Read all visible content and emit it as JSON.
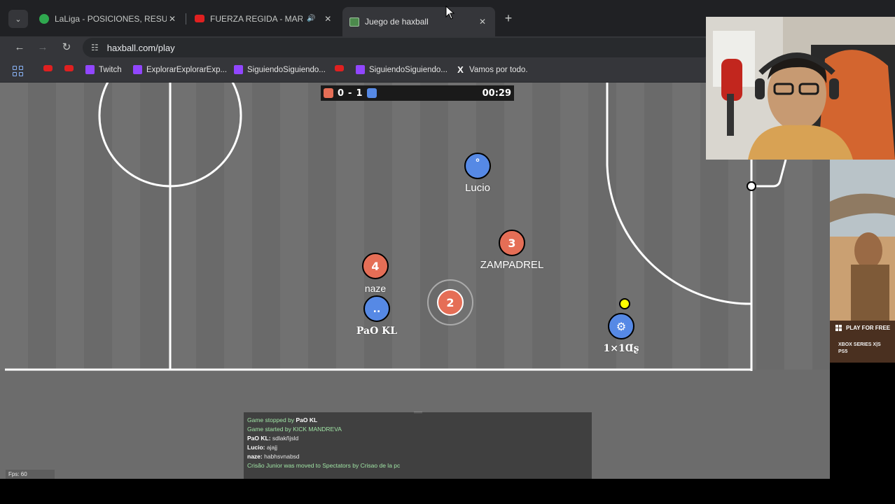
{
  "browser": {
    "tab_list_glyph": "⌄",
    "tabs": [
      {
        "title": "LaLiga - POSICIONES, RESULTADOS",
        "close": "✕"
      },
      {
        "title": "FUERZA REGIDA - MARLBORO",
        "audio": "🔊",
        "close": "✕"
      },
      {
        "title": "Juego de haxball",
        "close": "✕"
      }
    ],
    "new_tab": "+",
    "back": "←",
    "forward": "→",
    "reload": "↻",
    "url": "haxball.com/play",
    "bookmarks": [
      {
        "label": "",
        "icon": "youtube-icon"
      },
      {
        "label": "",
        "icon": "youtube-icon"
      },
      {
        "label": "Twitch",
        "icon": "twitch-icon"
      },
      {
        "label": "ExplorarExplorarExp...",
        "icon": "twitch-icon"
      },
      {
        "label": "SiguiendoSiguiendo...",
        "icon": "twitch-icon"
      },
      {
        "label": "",
        "icon": "youtube-icon"
      },
      {
        "label": "SiguiendoSiguiendo...",
        "icon": "twitch-icon"
      },
      {
        "label": "Vamos por todo.",
        "icon": "x-icon"
      }
    ]
  },
  "game": {
    "score": {
      "red": "0",
      "sep": "-",
      "blue": "1",
      "time": "00:29"
    },
    "colors": {
      "red": "#e56e56",
      "blue": "#5689e5",
      "field": "#6e6e6e",
      "line": "#ffffff",
      "ball": "#ffff00"
    },
    "players": [
      {
        "name": "Lucio",
        "team": "blue",
        "avatar": "°"
      },
      {
        "name": "ZAMPADREL",
        "team": "red",
        "avatar": "3"
      },
      {
        "name": "naze",
        "team": "red",
        "avatar": "4"
      },
      {
        "name": "PaO KL",
        "team": "blue",
        "avatar": ".."
      },
      {
        "name": "",
        "team": "red",
        "avatar": "2"
      },
      {
        "name": "1×1Ɑʂ",
        "team": "blue",
        "avatar": "⚙"
      }
    ],
    "chat": [
      {
        "type": "notice",
        "text": "Game stopped by ",
        "bold": "PaO KL"
      },
      {
        "type": "notice",
        "text": "Game started by KICK MANDREVA",
        "bold": ""
      },
      {
        "type": "msg",
        "bold": "PaO KL:",
        "text": " sdlakñjsld"
      },
      {
        "type": "msg",
        "bold": "Lucio:",
        "text": " ajajj"
      },
      {
        "type": "msg",
        "bold": "naze:",
        "text": " habhsvnabsd"
      },
      {
        "type": "notice",
        "text": "Crisão Junior was moved to Spectators by Crisao de la pc",
        "bold": ""
      }
    ],
    "fps": "Fps: 60"
  },
  "ad": {
    "cta": "PLAY FOR FREE",
    "platform1": "XBOX SERIES X|S",
    "platform2": "PS5"
  }
}
